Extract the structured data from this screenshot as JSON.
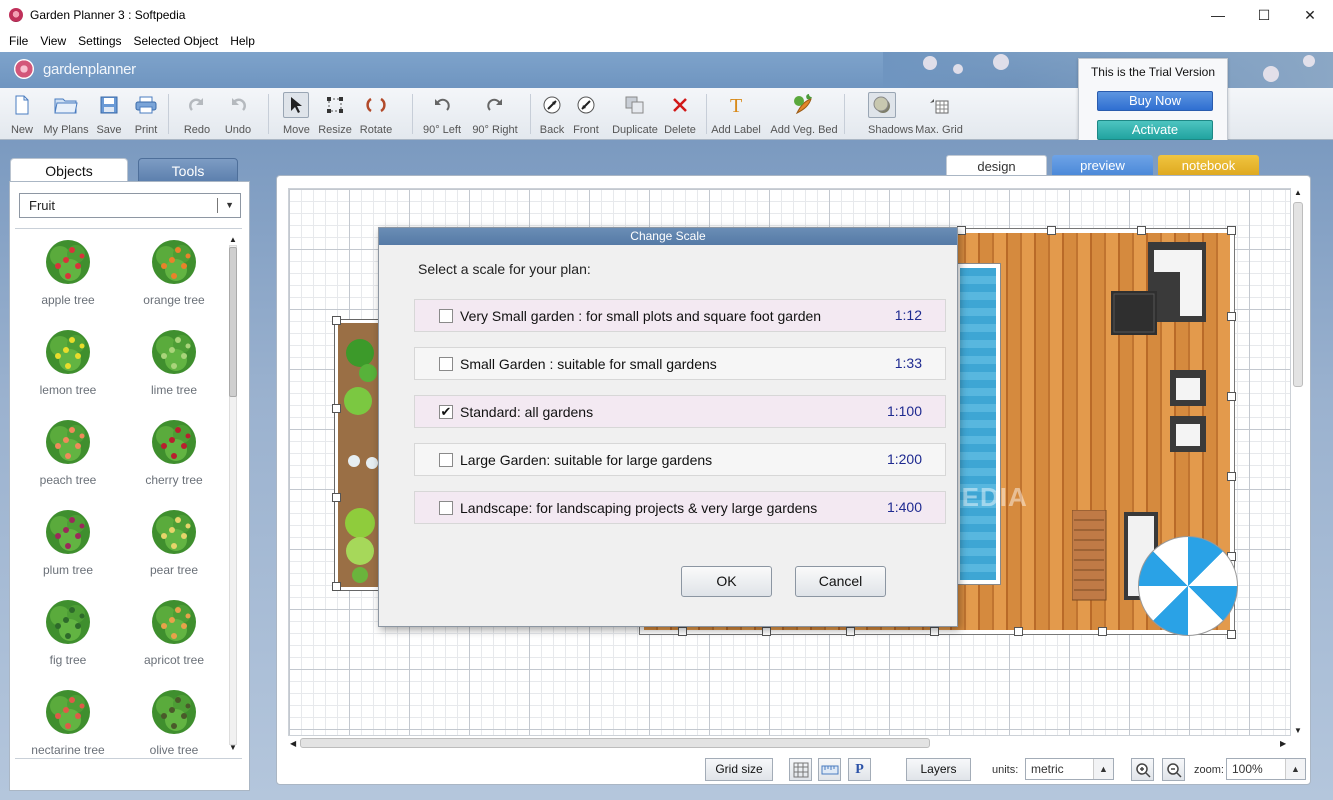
{
  "window": {
    "title": "Garden Planner 3 : Softpedia",
    "min": "—",
    "max": "☐",
    "close": "✕"
  },
  "menu": [
    "File",
    "View",
    "Settings",
    "Selected Object",
    "Help"
  ],
  "brand": {
    "name": "gardenplanner"
  },
  "toolbar": {
    "new": "New",
    "my_plans": "My Plans",
    "save": "Save",
    "print": "Print",
    "redo": "Redo",
    "undo": "Undo",
    "move": "Move",
    "resize": "Resize",
    "rotate": "Rotate",
    "rot_left": "90° Left",
    "rot_right": "90° Right",
    "back": "Back",
    "front": "Front",
    "duplicate": "Duplicate",
    "delete": "Delete",
    "add_label": "Add Label",
    "add_veg_bed": "Add Veg. Bed",
    "shadows": "Shadows",
    "max_grid": "Max. Grid"
  },
  "trial": {
    "text": "This is the Trial Version",
    "buy_now": "Buy Now",
    "activate": "Activate"
  },
  "panel": {
    "tab_objects": "Objects",
    "tab_tools": "Tools",
    "category": "Fruit",
    "items": [
      {
        "label": "apple tree",
        "color": "#d8343a"
      },
      {
        "label": "orange tree",
        "color": "#e9822a"
      },
      {
        "label": "lemon tree",
        "color": "#e8dc2c"
      },
      {
        "label": "lime tree",
        "color": "#a9d47a"
      },
      {
        "label": "peach tree",
        "color": "#f08a5a"
      },
      {
        "label": "cherry tree",
        "color": "#b8202e"
      },
      {
        "label": "plum tree",
        "color": "#9a2a5a"
      },
      {
        "label": "pear tree",
        "color": "#e6d46a"
      },
      {
        "label": "fig tree",
        "color": "#2e6a2a"
      },
      {
        "label": "apricot tree",
        "color": "#e8a24a"
      },
      {
        "label": "nectarine tree",
        "color": "#e05a48"
      },
      {
        "label": "olive tree",
        "color": "#4a5a2a"
      }
    ]
  },
  "view_tabs": {
    "design": "design",
    "preview": "preview",
    "notebook": "notebook"
  },
  "dialog": {
    "title": "Change Scale",
    "prompt": "Select a scale for your plan:",
    "options": [
      {
        "label": "Very Small garden : for small plots and square foot garden",
        "ratio": "1:12",
        "checked": ""
      },
      {
        "label": "Small Garden : suitable for small gardens",
        "ratio": "1:33",
        "checked": ""
      },
      {
        "label": "Standard: all gardens",
        "ratio": "1:100",
        "checked": "✔"
      },
      {
        "label": "Large Garden: suitable for large gardens",
        "ratio": "1:200",
        "checked": ""
      },
      {
        "label": "Landscape: for landscaping projects & very large gardens",
        "ratio": "1:400",
        "checked": ""
      }
    ],
    "ok": "OK",
    "cancel": "Cancel"
  },
  "bottom": {
    "grid_size": "Grid size",
    "p_label": "P",
    "layers": "Layers",
    "units_label": "units:",
    "units_value": "metric",
    "zoom_label": "zoom:",
    "zoom_value": "100%"
  },
  "watermark": "SOFTPEDIA"
}
